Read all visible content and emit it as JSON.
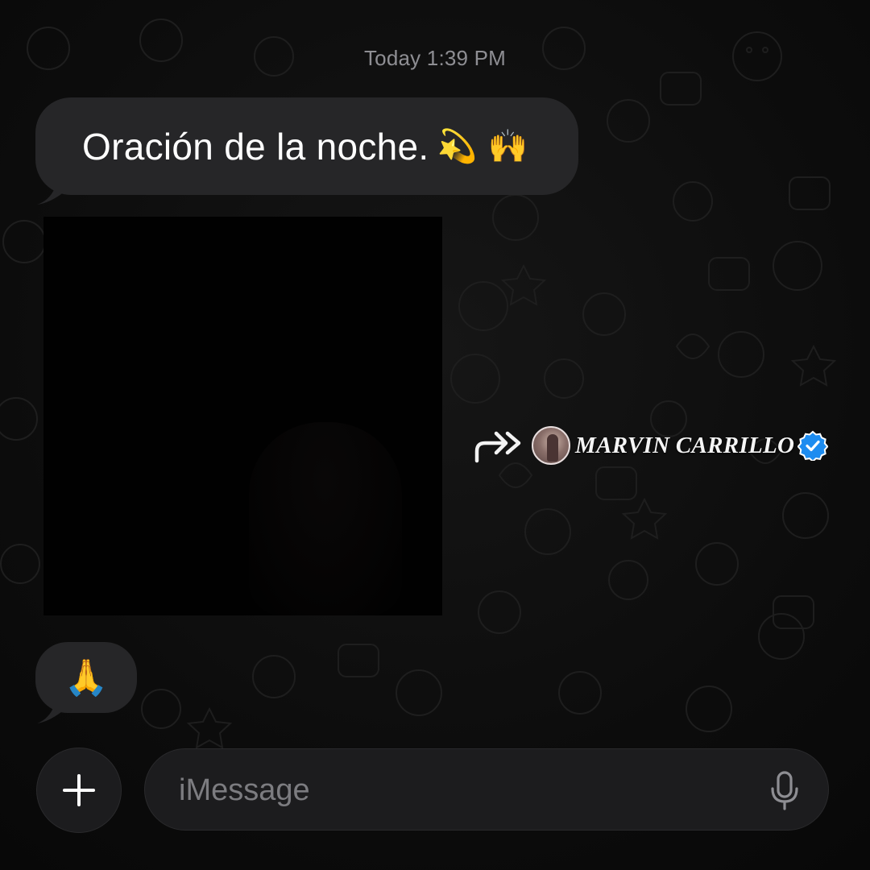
{
  "conversation": {
    "timestamp": "Today 1:39 PM",
    "messages": [
      {
        "text": "Oración de la noche.",
        "emoji": "💫 🙌"
      },
      {
        "emoji": "🙏"
      }
    ],
    "forward": {
      "name": "MARVIN CARRILLO"
    }
  },
  "composer": {
    "placeholder": "iMessage"
  },
  "icons": {
    "add": "plus-icon",
    "forward": "forward-arrow-icon",
    "verified": "verified-badge-icon",
    "mic": "microphone-icon"
  },
  "colors": {
    "background": "#0b0b0b",
    "bubble": "#262628",
    "timestamp": "#8e8e93",
    "verified": "#1d8cf0",
    "input": "#1c1c1e"
  }
}
